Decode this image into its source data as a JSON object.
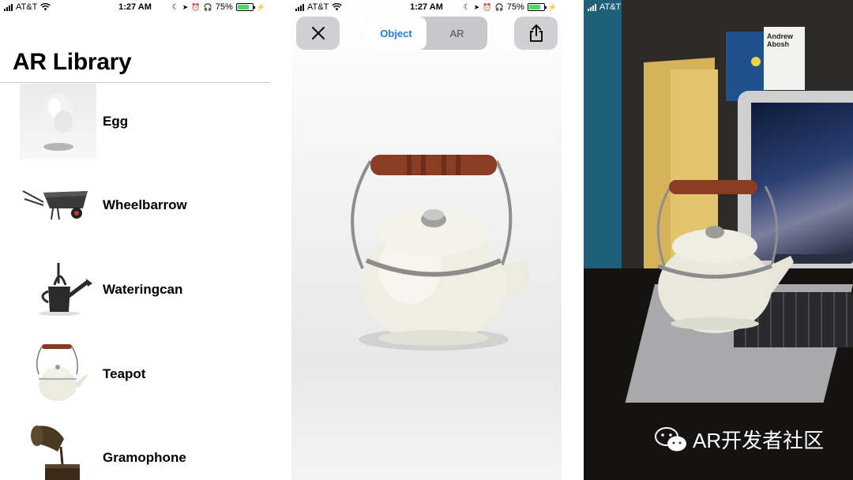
{
  "status_bar": {
    "carrier": "AT&T",
    "time": "1:27 AM",
    "battery": "75%",
    "battery_level": 0.75
  },
  "library": {
    "title": "AR Library",
    "items": [
      {
        "label": "Egg",
        "icon": "egg-thumbnail"
      },
      {
        "label": "Wheelbarrow",
        "icon": "wheelbarrow-thumbnail"
      },
      {
        "label": "Wateringcan",
        "icon": "watering-can-thumbnail"
      },
      {
        "label": "Teapot",
        "icon": "teapot-thumbnail"
      },
      {
        "label": "Gramophone",
        "icon": "gramophone-thumbnail"
      }
    ]
  },
  "viewer": {
    "close_icon": "close-icon",
    "share_icon": "share-icon",
    "tabs": [
      {
        "label": "Object",
        "selected": true
      },
      {
        "label": "AR",
        "selected": false
      }
    ],
    "accent_color": "#1f7be4"
  },
  "ar_view": {
    "card_name": "Andrew Abosh",
    "watermark": "AR开发者社区"
  }
}
